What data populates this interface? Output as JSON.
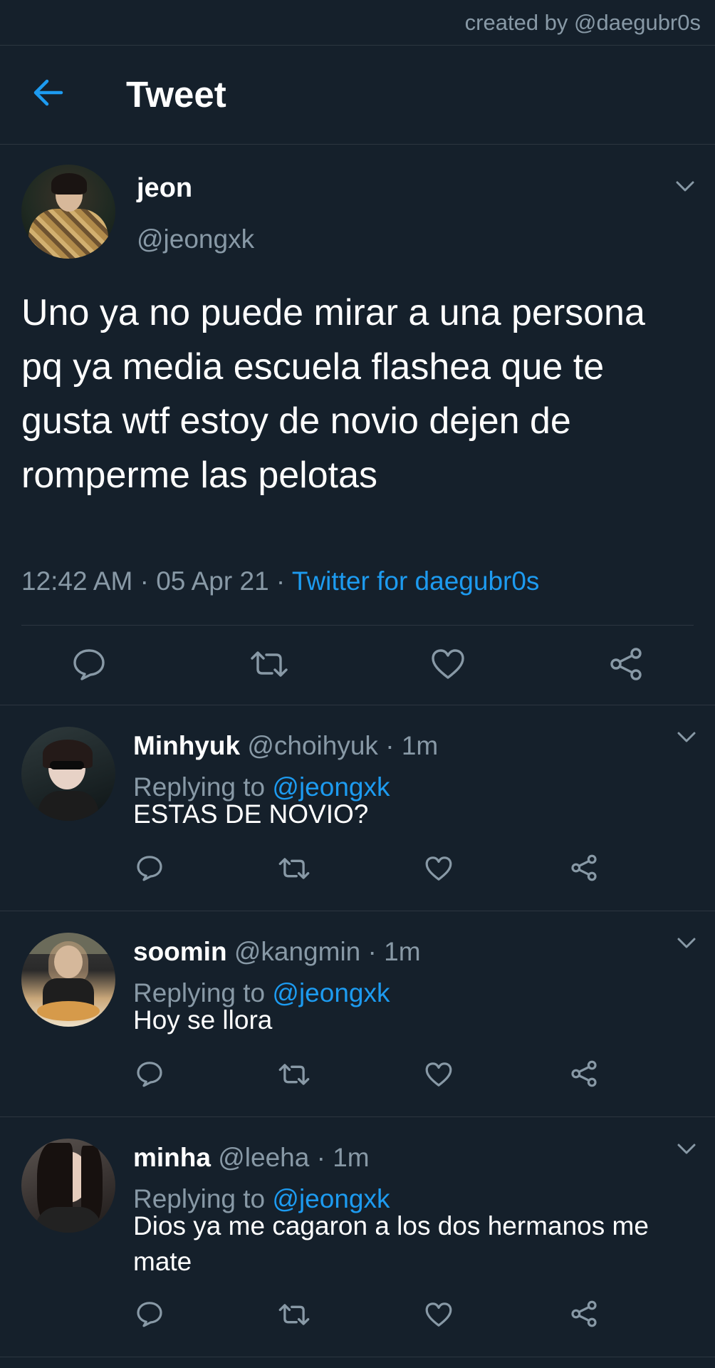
{
  "credit": "created by @daegubr0s",
  "header": {
    "title": "Tweet"
  },
  "tweet": {
    "name": "jeon",
    "handle": "@jeongxk",
    "text": "Uno ya no puede mirar a una persona pq ya media escuela flashea que te gusta wtf estoy de novio dejen de romperme las pelotas",
    "time": "12:42 AM",
    "date": "05 Apr 21",
    "source": "Twitter for daegubr0s",
    "separator": " · "
  },
  "replies": [
    {
      "name": "Minhyuk",
      "handle": "@choihyuk",
      "time": "1m",
      "replying_prefix": "Replying to ",
      "replying_to": "@jeongxk",
      "text": "ESTAS DE NOVIO?"
    },
    {
      "name": "soomin",
      "handle": "@kangmin",
      "time": "1m",
      "replying_prefix": "Replying to ",
      "replying_to": "@jeongxk",
      "text": "Hoy se llora"
    },
    {
      "name": "minha",
      "handle": "@leeha",
      "time": "1m",
      "replying_prefix": "Replying to ",
      "replying_to": "@jeongxk",
      "text": "Dios ya me cagaron a los dos hermanos me mate"
    }
  ],
  "icons": {
    "back": "arrow-left-icon",
    "menu": "chevron-down-icon",
    "reply": "comment-icon",
    "retweet": "retweet-icon",
    "like": "heart-icon",
    "share": "share-icon"
  },
  "colors": {
    "background": "#15202b",
    "accent": "#1d9bf0",
    "muted": "#8899a6",
    "divider": "#2c3640"
  }
}
